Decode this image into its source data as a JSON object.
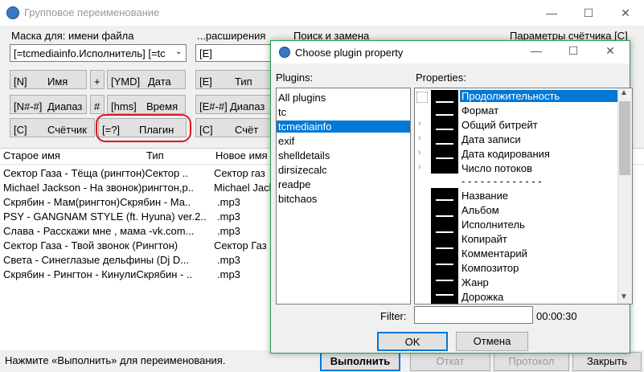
{
  "window": {
    "title": "Групповое переименование",
    "min": "—",
    "max": "☐",
    "close": "✕"
  },
  "mask": {
    "name_label": "Маска для: имени файла",
    "name_value": "[=tcmediainfo.Исполнитель] [=tc",
    "ext_label": "...расширения",
    "ext_value": "[E]",
    "search_label": "Поиск и замена",
    "counter_label": "Параметры счётчика [C]"
  },
  "buttons": {
    "n_code": "[N]",
    "n_label": "Имя",
    "plus": "+",
    "ymd_code": "[YMD]",
    "ymd_label": "Дата",
    "range_code": "[N#-#]",
    "range_label": "Диапаз",
    "hash": "#",
    "hms_code": "[hms]",
    "hms_label": "Время",
    "c_code": "[C]",
    "c_label": "Счётчик",
    "plugin_code": "[=?]",
    "plugin_label": "Плагин",
    "e_code": "[E]",
    "e_label": "Тип",
    "erange_code": "[E#-#]",
    "erange_label": "Диапаз",
    "ec_code": "[C]",
    "ec_label": "Счёт"
  },
  "list": {
    "headers": [
      "Старое имя",
      "Тип",
      "Новое имя"
    ],
    "rows": [
      [
        "Сектор Газа - Тёща (рингтон)",
        "Сектор ..",
        "Сектор газ"
      ],
      [
        "Michael Jackson - На звонок)",
        "рингтон,р..",
        "Michael Jack"
      ],
      [
        "Скрябин - Мам(рингтон)",
        "Скрябин - Ма..",
        ".mp3"
      ],
      [
        "PSY - GANGNAM STYLE (ft. Hyuna) ver.2..",
        "",
        ".mp3"
      ],
      [
        "Слава - Расскажи мне , мама -vk.com...",
        "",
        ".mp3"
      ],
      [
        "Сектор Газа - Твой звонок (Рингтон)",
        "",
        "Сектор Газ"
      ],
      [
        "Света - Синеглазые дельфины (Dj D...",
        "",
        ".mp3"
      ],
      [
        "Скрябин - Рингтон - Кинули",
        "Скрябин - ..",
        ".mp3"
      ]
    ]
  },
  "status": {
    "text": "Нажмите «Выполнить» для переименования.",
    "run": "Выполнить",
    "undo": "Откат",
    "log": "Протокол",
    "close": "Закрыть"
  },
  "dialog": {
    "title": "Choose plugin property",
    "plugins_label": "Plugins:",
    "properties_label": "Properties:",
    "plugins": [
      "All plugins",
      "tc",
      "tcmediainfo",
      "exif",
      "shelldetails",
      "dirsizecalc",
      "readpe",
      "bitchaos"
    ],
    "selected_plugin": "tcmediainfo",
    "properties": [
      "Продолжительность",
      "Формат",
      "Общий битрейт",
      "Дата записи",
      "Дата кодирования",
      "Число потоков",
      "- - - - - - - - - - - - -",
      "Название",
      "Альбом",
      "Исполнитель",
      "Копирайт",
      "Комментарий",
      "Композитор",
      "Жанр",
      "Дорожка"
    ],
    "filter_label": "Filter:",
    "filter_value": "",
    "duration_value": "00:00:30",
    "ok": "OK",
    "cancel": "Отмена",
    "min": "—",
    "max": "☐",
    "close": "✕"
  },
  "colors": {
    "highlight": "#0078d7",
    "accent_border": "#1ea345",
    "plugin_circle": "#e0141e"
  }
}
